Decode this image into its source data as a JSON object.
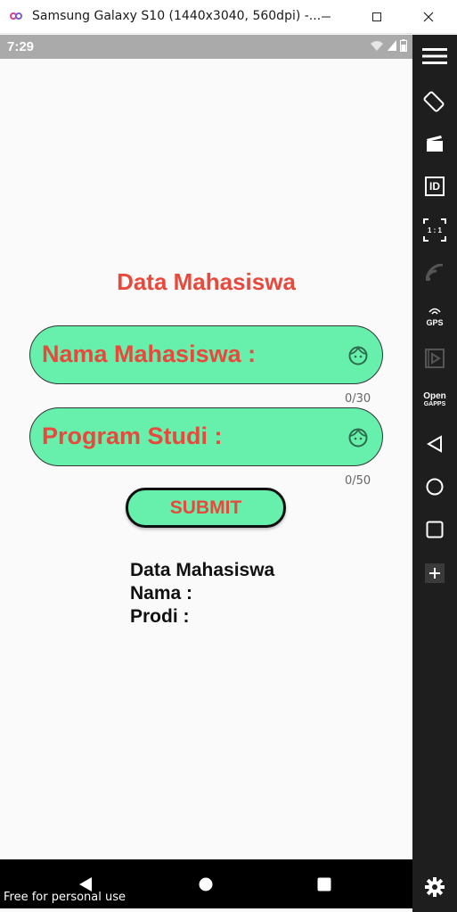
{
  "window": {
    "title": "Samsung Galaxy S10 (1440x3040, 560dpi) -..."
  },
  "status_bar": {
    "time": "7:29"
  },
  "app": {
    "heading": "Data Mahasiswa",
    "fields": [
      {
        "label": "Nama Mahasiswa :",
        "counter": "0/30",
        "icon": "face-icon"
      },
      {
        "label": "Program Studi :",
        "counter": "0/50",
        "icon": "face-icon"
      }
    ],
    "submit_label": "SUBMIT",
    "result": {
      "title": "Data Mahasiswa",
      "nama": "Nama :",
      "prodi": "Prodi :"
    }
  },
  "watermark": "Free for personal use",
  "toolbar": {
    "items": [
      "menu-icon",
      "rotate-icon",
      "screencast-icon",
      "id-icon",
      "resize-icon",
      "wifi-icon",
      "gps-icon",
      "media-icon",
      "open-gapps-icon",
      "back-icon",
      "home-icon",
      "recents-icon",
      "add-icon",
      "settings-icon"
    ],
    "gps_label": "GPS",
    "open_label": "Open",
    "gapps_label": "GAPPS",
    "resize_label": "1 : 1",
    "id_label": "ID"
  },
  "colors": {
    "accent_red": "#e9483c",
    "field_green": "#66f0ab",
    "toolbar_bg": "#1e1e1e",
    "status_gray": "#aaaaaa"
  }
}
